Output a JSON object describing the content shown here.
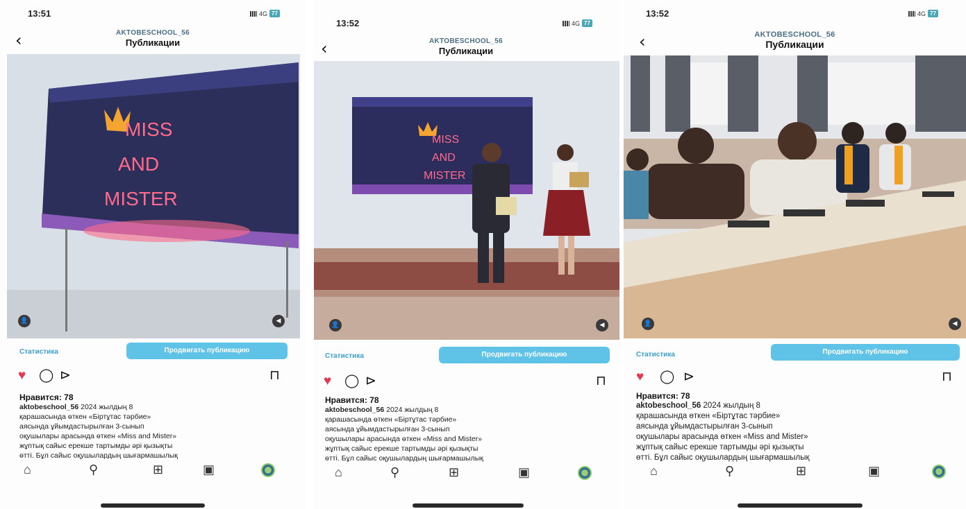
{
  "screens": [
    {
      "time": "13:51",
      "signal": "4G",
      "battery": "77",
      "back": "‹",
      "account": "AKTOBESCHOOL_56",
      "title": "Публикации",
      "screen_text": [
        "MISS",
        "AND",
        "MISTER"
      ],
      "stats": "Статистика",
      "promote": "Продвигать публикацию",
      "likes": "Нравится: 78",
      "caption_user": "aktobeschool_56",
      "caption_lines": [
        " 2024 жылдың 8",
        "қарашасында өткен «Біртұтас тәрбие»",
        "аясында ұйымдастырылған 3-сынып",
        "оқушылары арасында өткен «Miss and Mister»",
        "жұптық сайыс ерекше тартымды әрі қызықты",
        "өтті. Бұл сайыс оқушылардың шығармашылық"
      ]
    },
    {
      "time": "13:52",
      "signal": "4G",
      "battery": "77",
      "back": "‹",
      "account": "AKTOBESCHOOL_56",
      "title": "Публикации",
      "screen_text": [
        "MISS",
        "AND",
        "MISTER"
      ],
      "stats": "Статистика",
      "promote": "Продвигать публикацию",
      "likes": "Нравится: 78",
      "caption_user": "aktobeschool_56",
      "caption_lines": [
        " 2024 жылдың 8",
        "қарашасында өткен «Біртұтас тәрбие»",
        "аясында ұйымдастырылған 3-сынып",
        "оқушылары арасында өткен «Miss and Mister»",
        "жұптық сайыс ерекше тартымды әрі қызықты",
        "өтті. Бұл сайыс оқушылардың шығармашылық"
      ]
    },
    {
      "time": "13:52",
      "signal": "4G",
      "battery": "77",
      "back": "‹",
      "account": "AKTOBESCHOOL_56",
      "title": "Публикации",
      "stats": "Статистика",
      "promote": "Продвигать публикацию",
      "likes": "Нравится: 78",
      "caption_user": "aktobeschool_56",
      "caption_lines": [
        " 2024 жылдың 8",
        "қарашасында өткен «Біртұтас тәрбие»",
        "аясында ұйымдастырылған 3-сынып",
        "оқушылары арасында өткен «Miss and Mister»",
        "жұптық сайыс ерекше тартымды әрі қызықты",
        "өтті. Бұл сайыс оқушылардың шығармашылық"
      ]
    }
  ],
  "icons": {
    "heart": "♥",
    "comment": "◯",
    "share": "⊳",
    "bookmark": "⊓",
    "home": "⌂",
    "search": "⚲",
    "add": "⊞",
    "reels": "▣",
    "tag": "👤",
    "mute": "◀"
  },
  "colors": {
    "accent": "#3a9fd0",
    "promote_bg": "#5ec3e6",
    "like": "#e53953",
    "screen_text": "#ff6b8b"
  }
}
